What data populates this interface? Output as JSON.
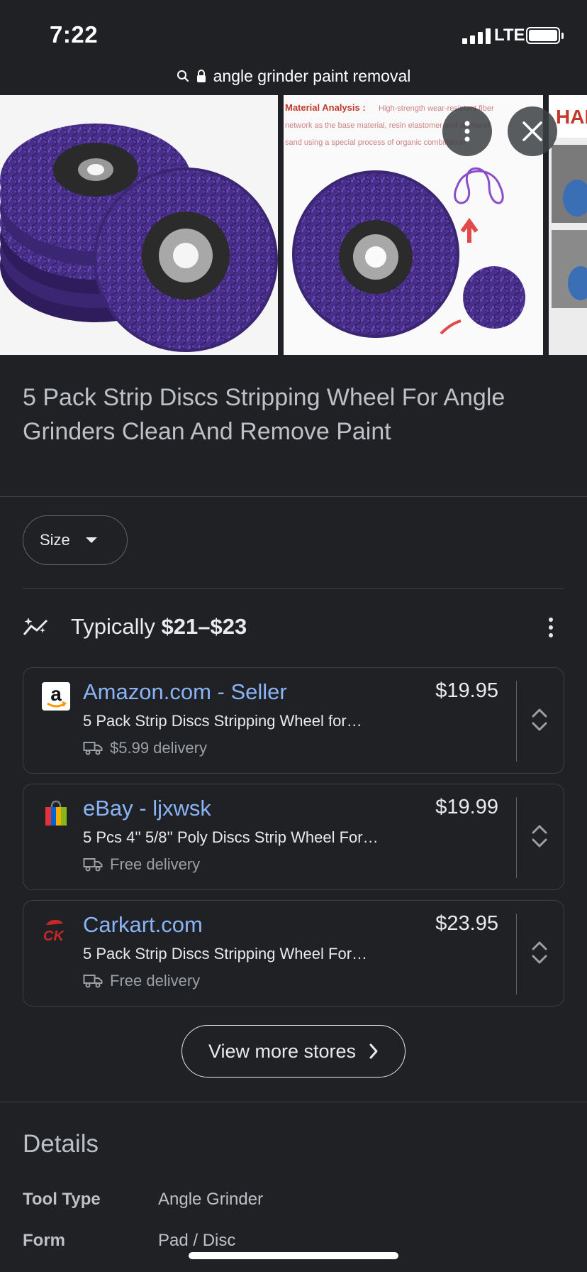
{
  "status_bar": {
    "time": "7:22",
    "network": "LTE"
  },
  "url_bar": {
    "text": "angle grinder paint removal"
  },
  "images": {
    "overlay_text": "Material Analysis : High-strength wear-resistant fiber network as the base material, resin elastomer and diamond sand using a special process of organic combination",
    "third_image_text": "HAM"
  },
  "product": {
    "title": "5 Pack Strip Discs Stripping Wheel For Angle Grinders Clean And Remove Paint"
  },
  "filters": {
    "size_label": "Size"
  },
  "pricing": {
    "typically_label": "Typically",
    "range": "$21–$23"
  },
  "stores": [
    {
      "name": "Amazon.com - Seller",
      "price": "$19.95",
      "desc": "5 Pack Strip Discs Stripping Wheel for…",
      "delivery": "$5.99 delivery"
    },
    {
      "name": "eBay - ljxwsk",
      "price": "$19.99",
      "desc": "5 Pcs 4'' 5/8'' Poly Discs Strip Wheel For…",
      "delivery": "Free delivery"
    },
    {
      "name": "Carkart.com",
      "price": "$23.95",
      "desc": "5 Pack Strip Discs Stripping Wheel For…",
      "delivery": "Free delivery"
    }
  ],
  "view_more": {
    "label": "View more stores"
  },
  "details": {
    "title": "Details",
    "rows": [
      {
        "key": "Tool Type",
        "value": "Angle Grinder"
      },
      {
        "key": "Form",
        "value": "Pad / Disc"
      }
    ]
  },
  "colors": {
    "background": "#202124",
    "link": "#8ab4f8",
    "disc_purple": "#5b3fa0"
  },
  "logos": {
    "amazon": "a",
    "carkart": "CK"
  }
}
